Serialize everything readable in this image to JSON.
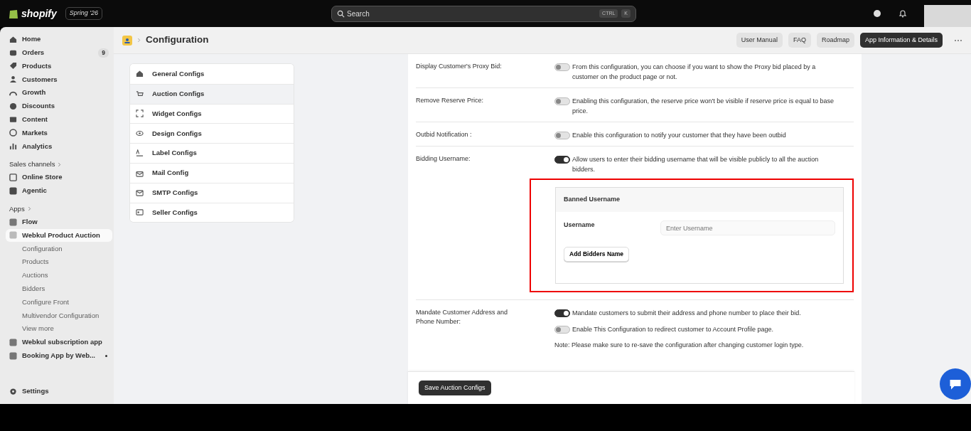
{
  "topbar": {
    "logo": "shopify",
    "edition": "Spring '26",
    "search": {
      "placeholder": "Search",
      "keys": [
        "CTRL",
        "K"
      ]
    }
  },
  "sidebar": {
    "sections": [
      {
        "items": [
          {
            "label": "Home",
            "selected": false
          },
          {
            "label": "Orders",
            "count": "9",
            "selected": false
          },
          {
            "label": "Products",
            "selected": false
          },
          {
            "label": "Customers",
            "selected": false
          },
          {
            "label": "Growth",
            "selected": false
          },
          {
            "label": "Discounts",
            "selected": false
          },
          {
            "label": "Content",
            "selected": false
          },
          {
            "label": "Markets",
            "selected": false
          },
          {
            "label": "Analytics",
            "selected": false
          }
        ]
      },
      {
        "heading": "Sales channels",
        "items": [
          {
            "label": "Online Store",
            "selected": false
          },
          {
            "label": "Agentic",
            "selected": false
          }
        ]
      },
      {
        "heading": "Apps",
        "items": [
          {
            "label": "Flow",
            "selected": false
          },
          {
            "label": "Webkul Product Auction",
            "selected": true,
            "children": [
              {
                "label": "Configuration"
              },
              {
                "label": "Products"
              },
              {
                "label": "Auctions"
              },
              {
                "label": "Bidders"
              },
              {
                "label": "Configure Front"
              },
              {
                "label": "Multivendor Configuration"
              },
              {
                "label": "View more"
              }
            ]
          },
          {
            "label": "Webkul subscription app",
            "selected": false
          },
          {
            "label": "Booking App by Web...",
            "selected": false,
            "unread": true
          }
        ]
      }
    ],
    "footer": {
      "label": "Settings"
    }
  },
  "header": {
    "title": "Configuration",
    "buttons": [
      {
        "label": "User Manual",
        "primary": false
      },
      {
        "label": "FAQ",
        "primary": false
      },
      {
        "label": "Roadmap",
        "primary": false
      },
      {
        "label": "App Information & Details",
        "primary": true
      }
    ],
    "more": "⋯"
  },
  "config_menu": [
    {
      "label": "General Configs",
      "selected": false
    },
    {
      "label": "Auction Configs",
      "selected": true
    },
    {
      "label": "Widget Configs",
      "selected": false
    },
    {
      "label": "Design Configs",
      "selected": false
    },
    {
      "label": "Label Configs",
      "selected": false
    },
    {
      "label": "Mail Config",
      "selected": false
    },
    {
      "label": "SMTP Configs",
      "selected": false
    },
    {
      "label": "Seller Configs",
      "selected": false
    }
  ],
  "settings": [
    {
      "label": "Display Customer's Proxy Bid:",
      "options": [
        {
          "on": false,
          "text": "From this configuration, you can choose if you want to show the Proxy bid placed by a customer on the product page or not."
        }
      ]
    },
    {
      "label": "Remove Reserve Price:",
      "options": [
        {
          "on": false,
          "text": "Enabling this configuration, the reserve price won't be visible if reserve price is equal to base price."
        }
      ]
    },
    {
      "label": "Outbid Notification :",
      "options": [
        {
          "on": false,
          "text": "Enable this configuration to notify your customer that they have been outbid"
        }
      ]
    },
    {
      "label": "Bidding Username:",
      "options": [
        {
          "on": true,
          "text": "Allow users to enter their bidding username that will be visible publicly to all the auction bidders."
        }
      ],
      "banned": {
        "highlighted": true,
        "title": "Banned Username",
        "field_label": "Username",
        "placeholder": "Enter Username",
        "button": "Add Bidders Name"
      }
    },
    {
      "label": "Mandate Customer Address and Phone Number:",
      "options": [
        {
          "on": true,
          "text": "Mandate customers to submit their address and phone number to place their bid."
        },
        {
          "on": false,
          "text": "Enable This Configuration to redirect customer to Account Profile page."
        }
      ],
      "note": "Note:  Please make sure to re-save the configuration after changing customer login type."
    }
  ],
  "save_button": "Save Auction Configs"
}
